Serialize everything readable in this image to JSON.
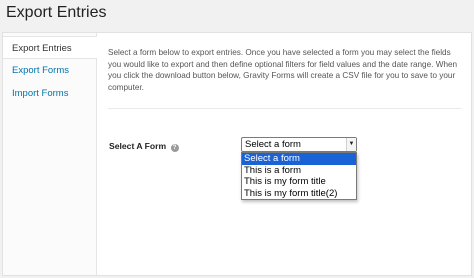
{
  "page": {
    "title": "Export Entries"
  },
  "sidebar": {
    "items": [
      {
        "label": "Export Entries"
      },
      {
        "label": "Export Forms"
      },
      {
        "label": "Import Forms"
      }
    ]
  },
  "main": {
    "intro": "Select a form below to export entries. Once you have selected a form you may select the fields you would like to export and then define optional filters for field values and the date range. When you click the download button below, Gravity Forms will create a CSV file for you to save to your computer.",
    "select_form": {
      "label": "Select A Form",
      "help_icon": "?",
      "selected_value": "Select a form",
      "arrow": "▼",
      "options": [
        {
          "label": "Select a form"
        },
        {
          "label": "This is a form"
        },
        {
          "label": "This is my form title"
        },
        {
          "label": "This is my form title(2)"
        }
      ]
    }
  },
  "colors": {
    "link": "#0073aa",
    "selected_option": "#1a63d6"
  }
}
